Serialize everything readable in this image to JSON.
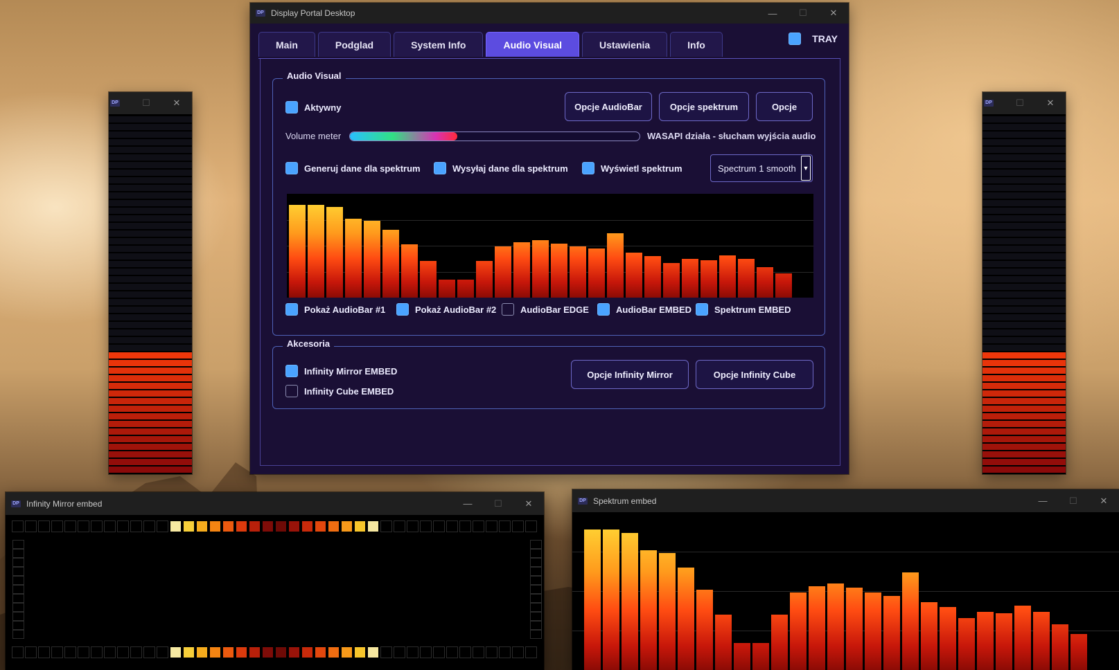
{
  "main_window": {
    "title": "Display Portal Desktop",
    "logo": "DP",
    "tabs": [
      {
        "label": "Main",
        "active": false
      },
      {
        "label": "Podglad",
        "active": false
      },
      {
        "label": "System Info",
        "active": false
      },
      {
        "label": "Audio Visual",
        "active": true
      },
      {
        "label": "Ustawienia",
        "active": false
      },
      {
        "label": "Info",
        "active": false
      }
    ],
    "tray_label": "TRAY",
    "tray_checked": true
  },
  "audio_visual": {
    "group_title": "Audio Visual",
    "active_label": "Aktywny",
    "active_checked": true,
    "buttons": {
      "audiobar_options": "Opcje AudioBar",
      "spectrum_options": "Opcje spektrum",
      "options": "Opcje"
    },
    "volume_label": "Volume meter",
    "volume_level": 0.37,
    "status": "WASAPI działa - słucham wyjścia audio",
    "checks_row1": [
      {
        "label": "Generuj dane dla spektrum",
        "checked": true
      },
      {
        "label": "Wysyłaj dane dla spektrum",
        "checked": true
      },
      {
        "label": "Wyświetl spektrum",
        "checked": true
      }
    ],
    "spectrum_mode": "Spectrum 1 smooth",
    "checks_row2": [
      {
        "label": "Pokaż AudioBar #1",
        "checked": true
      },
      {
        "label": "Pokaż AudioBar #2",
        "checked": true
      },
      {
        "label": "AudioBar EDGE",
        "checked": false
      },
      {
        "label": "AudioBar EMBED",
        "checked": true
      },
      {
        "label": "Spektrum EMBED",
        "checked": true
      }
    ]
  },
  "accessories": {
    "group_title": "Akcesoria",
    "checks": [
      {
        "label": "Infinity Mirror EMBED",
        "checked": true
      },
      {
        "label": "Infinity Cube EMBED",
        "checked": false
      }
    ],
    "buttons": {
      "mirror_options": "Opcje Infinity Mirror",
      "cube_options": "Opcje Infinity Cube"
    }
  },
  "spectrum_levels": [
    0.89,
    0.89,
    0.87,
    0.76,
    0.74,
    0.65,
    0.51,
    0.35,
    0.17,
    0.17,
    0.35,
    0.49,
    0.53,
    0.55,
    0.52,
    0.49,
    0.47,
    0.62,
    0.43,
    0.4,
    0.33,
    0.37,
    0.36,
    0.41,
    0.37,
    0.29,
    0.23
  ],
  "side_bars": {
    "logo": "DP",
    "level": 0.34
  },
  "mirror_window": {
    "title": "Infinity Mirror embed",
    "logo": "DP",
    "top_row_lit": [
      "#f6e9a2",
      "#f7cf3a",
      "#f6ac1d",
      "#f48412",
      "#ec5a0f",
      "#dc3a0d",
      "#b8200a",
      "#7e0c08",
      "#6e0a06",
      "#991309",
      "#c82a0b",
      "#e3470d",
      "#f06d11",
      "#f6991a",
      "#f7c52b",
      "#f6e7a0"
    ],
    "top_row_start": 12,
    "bottom_row_start": 12
  },
  "spectrum_window": {
    "title": "Spektrum embed",
    "logo": "DP"
  },
  "colors": {
    "accent": "#5c4ce0",
    "checkbox_on": "#4aa3ff",
    "panel_bg": "#1a0f35"
  }
}
